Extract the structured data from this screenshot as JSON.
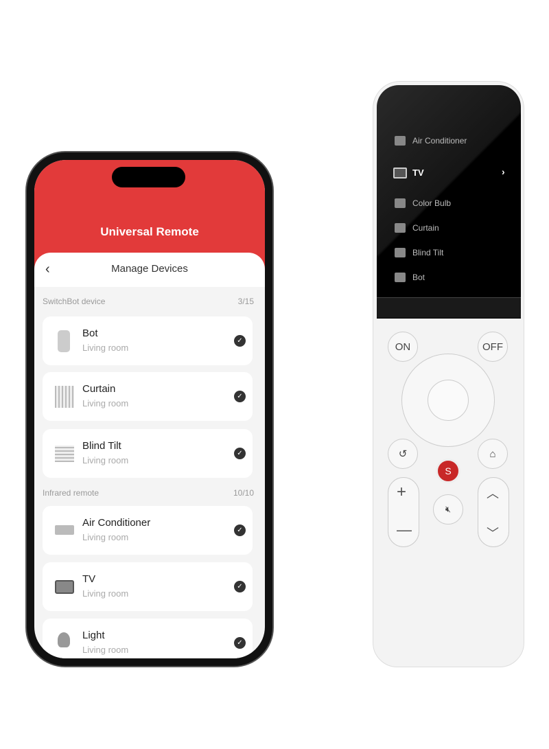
{
  "app": {
    "title": "Universal Remote",
    "sheet_title": "Manage Devices"
  },
  "sections": [
    {
      "label": "SwitchBot device",
      "count": "3/15",
      "items": [
        {
          "name": "Bot",
          "room": "Living room",
          "icon": "bot-icon",
          "checked": true
        },
        {
          "name": "Curtain",
          "room": "Living room",
          "icon": "curtain-icon",
          "checked": true
        },
        {
          "name": "Blind Tilt",
          "room": "Living room",
          "icon": "blind-tilt-icon",
          "checked": true
        }
      ]
    },
    {
      "label": "Infrared remote",
      "count": "10/10",
      "items": [
        {
          "name": "Air Conditioner",
          "room": "Living room",
          "icon": "air-conditioner-icon",
          "checked": true
        },
        {
          "name": "TV",
          "room": "Living room",
          "icon": "tv-icon",
          "checked": true
        },
        {
          "name": "Light",
          "room": "Living room",
          "icon": "light-bulb-icon",
          "checked": true
        }
      ]
    }
  ],
  "remote": {
    "menu": [
      {
        "label": "Air Conditioner"
      },
      {
        "label": "TV",
        "selected": true
      },
      {
        "label": "Color Bulb"
      },
      {
        "label": "Curtain"
      },
      {
        "label": "Blind Tilt"
      },
      {
        "label": "Bot"
      }
    ],
    "on_label": "ON",
    "off_label": "OFF",
    "selected_arrow": "›"
  },
  "colors": {
    "accent": "#e23a3a",
    "check": "#333333"
  }
}
